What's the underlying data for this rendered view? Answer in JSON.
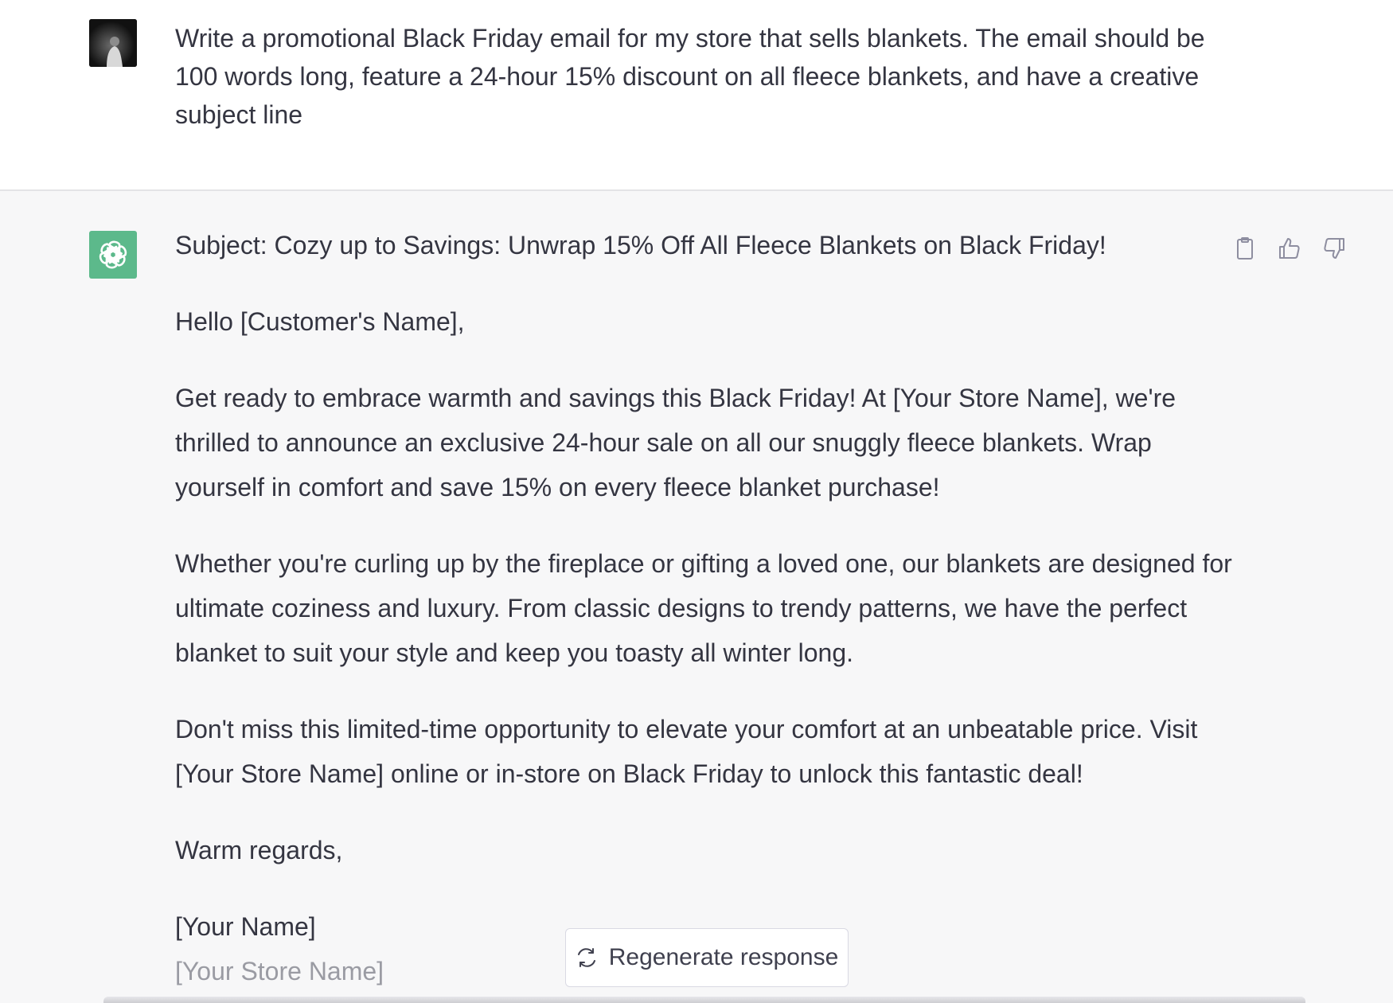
{
  "user_message": {
    "text": "Write a promotional Black Friday email for my store that sells blankets. The email should be 100 words long, feature a 24-hour 15% discount on all fleece blankets, and have a creative subject line"
  },
  "assistant_message": {
    "subject": "Subject: Cozy up to Savings: Unwrap 15% Off All Fleece Blankets on Black Friday!",
    "greeting": "Hello [Customer's Name],",
    "paragraph_1": "Get ready to embrace warmth and savings this Black Friday! At [Your Store Name], we're thrilled to announce an exclusive 24-hour sale on all our snuggly fleece blankets. Wrap yourself in comfort and save 15% on every fleece blanket purchase!",
    "paragraph_2": "Whether you're curling up by the fireplace or gifting a loved one, our blankets are designed for ultimate coziness and luxury. From classic designs to trendy patterns, we have the perfect blanket to suit your style and keep you toasty all winter long.",
    "paragraph_3": "Don't miss this limited-time opportunity to elevate your comfort at an unbeatable price. Visit [Your Store Name] online or in-store on Black Friday to unlock this fantastic deal!",
    "closing": "Warm regards,",
    "sig_name": "[Your Name]",
    "sig_store": "[Your Store Name]"
  },
  "actions": {
    "icons": [
      "clipboard-icon",
      "thumbs-up-icon",
      "thumbs-down-icon"
    ]
  },
  "regenerate": {
    "label": "Regenerate response",
    "icon": "refresh-icon"
  },
  "colors": {
    "assistant_avatar_bg": "#5cb98b",
    "assistant_bg": "#f7f7f8",
    "text": "#343541"
  }
}
